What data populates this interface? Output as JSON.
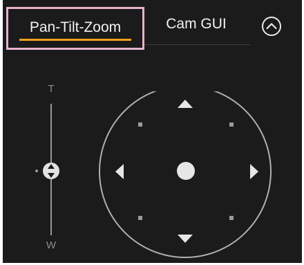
{
  "tabs": [
    {
      "label": "Pan-Tilt-Zoom",
      "selected": true
    },
    {
      "label": "Cam GUI",
      "selected": false
    }
  ],
  "collapse_button": {
    "icon": "chevron-up-circle-icon"
  },
  "zoom": {
    "tele_label": "T",
    "wide_label": "W",
    "level": 0.5
  },
  "ptz_pad": {
    "directions": [
      "up",
      "down",
      "left",
      "right",
      "up-left",
      "up-right",
      "down-left",
      "down-right"
    ],
    "center": "home"
  },
  "colors": {
    "panel_background": "#1b1b1b",
    "text": "#f1f1f1",
    "accent_underline": "#f2a21a",
    "selection_highlight": "#e6b3cd",
    "control_gray": "#9a9a9a"
  }
}
